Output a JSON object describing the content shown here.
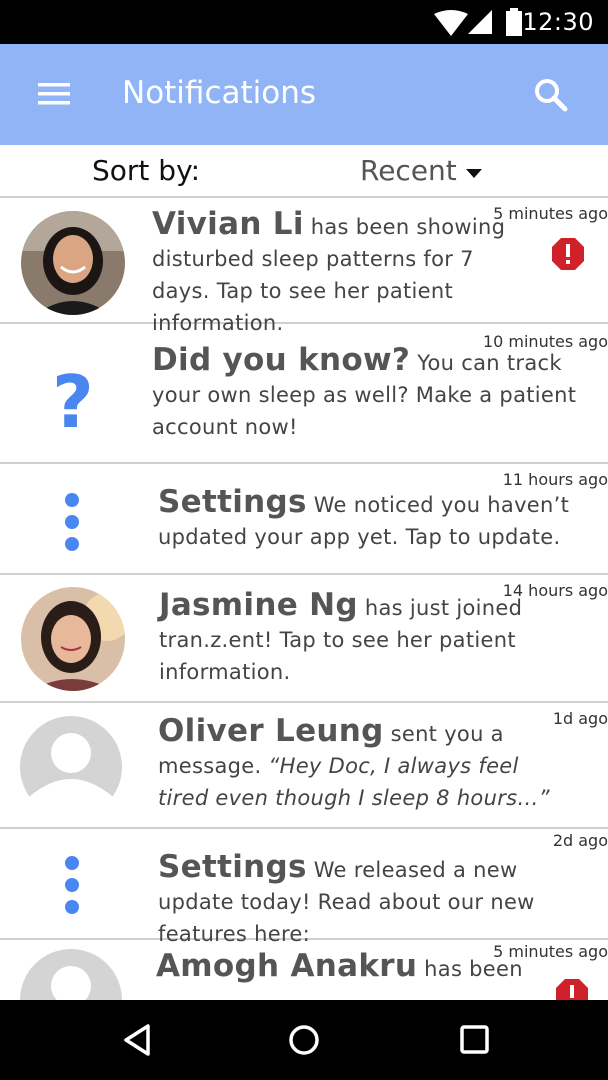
{
  "status_bar": {
    "time": "12:30",
    "icons": [
      "wifi-icon",
      "signal-icon",
      "battery-icon"
    ]
  },
  "app_bar": {
    "title": "Notifications",
    "menu_icon": "hamburger-menu-icon",
    "search_icon": "search-icon",
    "color": "#91b4f7"
  },
  "sort": {
    "label": "Sort by:",
    "value": "Recent"
  },
  "notifications": [
    {
      "name": "Vivian Li",
      "text": " has been showing disturbed sleep patterns for 7 days. Tap to see her patient information.",
      "time": "5 minutes ago",
      "icon": "avatar-photo",
      "alert": true
    },
    {
      "name": "Did you know?",
      "text": " You can track your own sleep as well? Make a patient account now!",
      "time": "10 minutes ago",
      "icon": "question-icon"
    },
    {
      "name": "Settings",
      "text": " We noticed you haven’t updated your app yet. Tap to update.",
      "time": "11 hours ago",
      "icon": "more-vert-icon"
    },
    {
      "name": "Jasmine Ng",
      "text": " has just joined tran.z.ent! Tap to see her patient information.",
      "time": "14 hours ago",
      "icon": "avatar-photo"
    },
    {
      "name": "Oliver Leung",
      "text": " sent you a message.",
      "quote": " “Hey Doc, I always feel tired even though I sleep 8 hours…”",
      "time": "1d ago",
      "icon": "avatar-placeholder"
    },
    {
      "name": "Settings",
      "text": " We released a new update today! Read about our new features here:",
      "time": "2d ago",
      "icon": "more-vert-icon"
    },
    {
      "name": "Amogh Anakru",
      "text": " has been",
      "time": "5 minutes ago",
      "icon": "avatar-placeholder",
      "alert": true
    }
  ],
  "colors": {
    "accent": "#4a86f0",
    "alert": "#d0212b"
  },
  "nav_bar": {
    "icons": [
      "back-icon",
      "home-icon",
      "recents-icon"
    ]
  }
}
